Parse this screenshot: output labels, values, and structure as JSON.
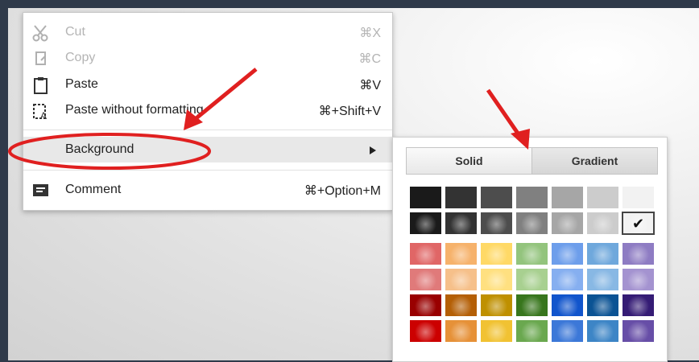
{
  "menu": {
    "items": [
      {
        "label": "Cut",
        "shortcut": "⌘X",
        "icon": "scissors-icon",
        "disabled": true
      },
      {
        "label": "Copy",
        "shortcut": "⌘C",
        "icon": "copy-icon",
        "disabled": true
      },
      {
        "label": "Paste",
        "shortcut": "⌘V",
        "icon": "paste-icon",
        "disabled": false
      },
      {
        "label": "Paste without formatting",
        "shortcut": "⌘+Shift+V",
        "icon": "paste-plain-icon",
        "disabled": false
      }
    ],
    "background_label": "Background",
    "comment": {
      "label": "Comment",
      "shortcut": "⌘+Option+M",
      "icon": "comment-icon"
    }
  },
  "panel": {
    "tabs": {
      "solid": "Solid",
      "gradient": "Gradient"
    },
    "grays": [
      "#1a1a1a",
      "#333333",
      "#4d4d4d",
      "#808080",
      "#a6a6a6",
      "#cccccc",
      "#f2f2f2"
    ],
    "colors": [
      [
        "#e06666",
        "#f6b26b",
        "#ffd966",
        "#93c47d",
        "#6d9eeb",
        "#6fa8dc",
        "#8e7cc3"
      ],
      [
        "#e07a7a",
        "#f6c08a",
        "#ffe080",
        "#a8d090",
        "#86aff0",
        "#88b8e4",
        "#a493d0"
      ],
      [
        "#990000",
        "#b45f06",
        "#bf9000",
        "#38761d",
        "#1155cc",
        "#0b5394",
        "#351c75"
      ],
      [
        "#cc0000",
        "#e69138",
        "#f1c232",
        "#6aa84f",
        "#3c78d8",
        "#3d85c6",
        "#674ea7"
      ]
    ],
    "selected": "gray-row2-col7",
    "check": "✔"
  },
  "annotation_color": "#e02020"
}
